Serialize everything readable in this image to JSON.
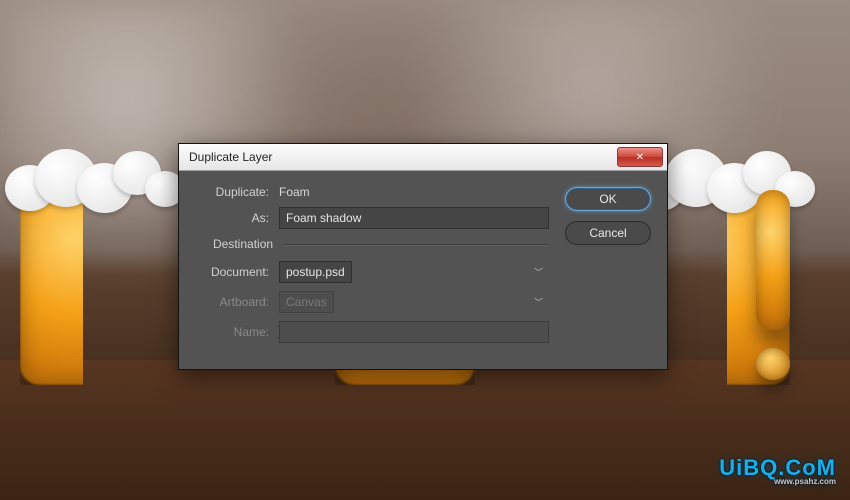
{
  "dialog": {
    "title": "Duplicate Layer",
    "fields": {
      "duplicate_label": "Duplicate:",
      "duplicate_value": "Foam",
      "as_label": "As:",
      "as_value": "Foam shadow",
      "destination_group": "Destination",
      "document_label": "Document:",
      "document_value": "postup.psd",
      "artboard_label": "Artboard:",
      "artboard_value": "Canvas",
      "name_label": "Name:",
      "name_value": ""
    },
    "buttons": {
      "ok": "OK",
      "cancel": "Cancel",
      "close": "✕"
    }
  },
  "watermark": {
    "main": "UiBQ.CoM",
    "sub": "www.psahz.com"
  }
}
